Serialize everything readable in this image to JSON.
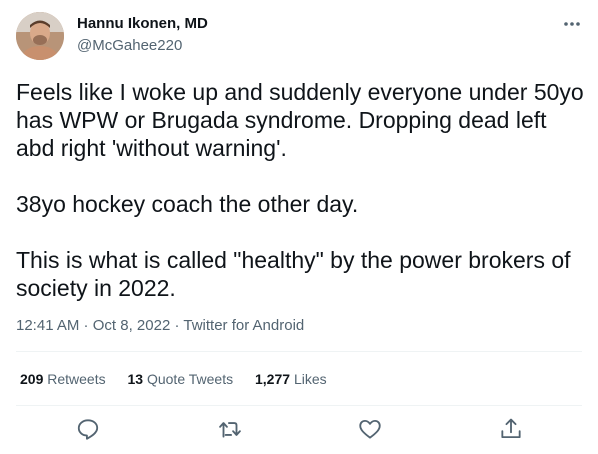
{
  "author": {
    "name": "Hannu Ikonen, MD",
    "handle": "@McGahee220",
    "avatar_icon": "profile-photo"
  },
  "tweet": {
    "paragraphs": [
      "Feels like I woke up and suddenly everyone under 50yo\nhas WPW or Brugada syndrome. Dropping dead left\nabd right 'without warning'.",
      "38yo hockey coach the other day.",
      "This is what is called \"healthy\" by the power brokers of\nsociety in 2022."
    ],
    "time": "12:41 AM",
    "date": "Oct 8, 2022",
    "source": "Twitter for Android",
    "separator": " · "
  },
  "stats": {
    "retweets_count": "209",
    "retweets_label": "Retweets",
    "quotes_count": "13",
    "quotes_label": "Quote Tweets",
    "likes_count": "1,277",
    "likes_label": "Likes"
  },
  "actions": [
    "reply-icon",
    "retweet-icon",
    "like-icon",
    "share-icon"
  ],
  "colors": {
    "text": "#0f1419",
    "secondary": "#536471",
    "divider": "#eff3f4"
  }
}
